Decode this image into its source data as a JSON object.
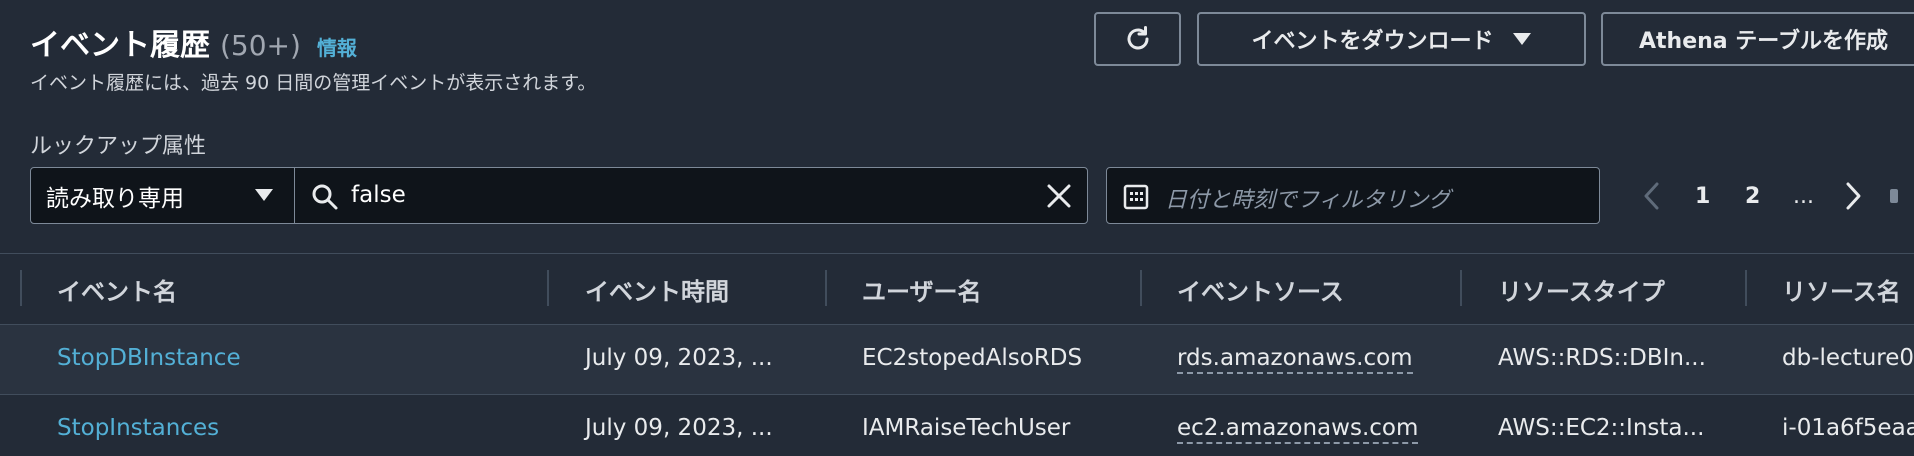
{
  "header": {
    "title": "イベント履歴",
    "count": "(50+)",
    "info_link": "情報",
    "subtitle": "イベント履歴には、過去 90 日間の管理イベントが表示されます。"
  },
  "actions": {
    "refresh_icon": "refresh-icon",
    "download_label": "イベントをダウンロード",
    "athena_label": "Athena テーブルを作成"
  },
  "lookup": {
    "label": "ルックアップ属性",
    "attribute_value": "読み取り専用",
    "search_value": "false",
    "date_placeholder": "日付と時刻でフィルタリング"
  },
  "pagination": {
    "pages": [
      "1",
      "2"
    ],
    "ellipsis": "..."
  },
  "table": {
    "columns": [
      "イベント名",
      "イベント時間",
      "ユーザー名",
      "イベントソース",
      "リソースタイプ",
      "リソース名"
    ],
    "rows": [
      {
        "event_name": "StopDBInstance",
        "event_time": "July 09, 2023, ...",
        "user_name": "EC2stopedAlsoRDS",
        "event_source": "rds.amazonaws.com",
        "resource_type": "AWS::RDS::DBIn...",
        "resource_name": "db-lecture0"
      },
      {
        "event_name": "StopInstances",
        "event_time": "July 09, 2023, ...",
        "user_name": "IAMRaiseTechUser",
        "event_source": "ec2.amazonaws.com",
        "resource_type": "AWS::EC2::Insta...",
        "resource_name": "i-01a6f5eaa"
      }
    ]
  },
  "colors": {
    "background": "#232b37",
    "link": "#53b0d6",
    "border": "#7d8998"
  }
}
